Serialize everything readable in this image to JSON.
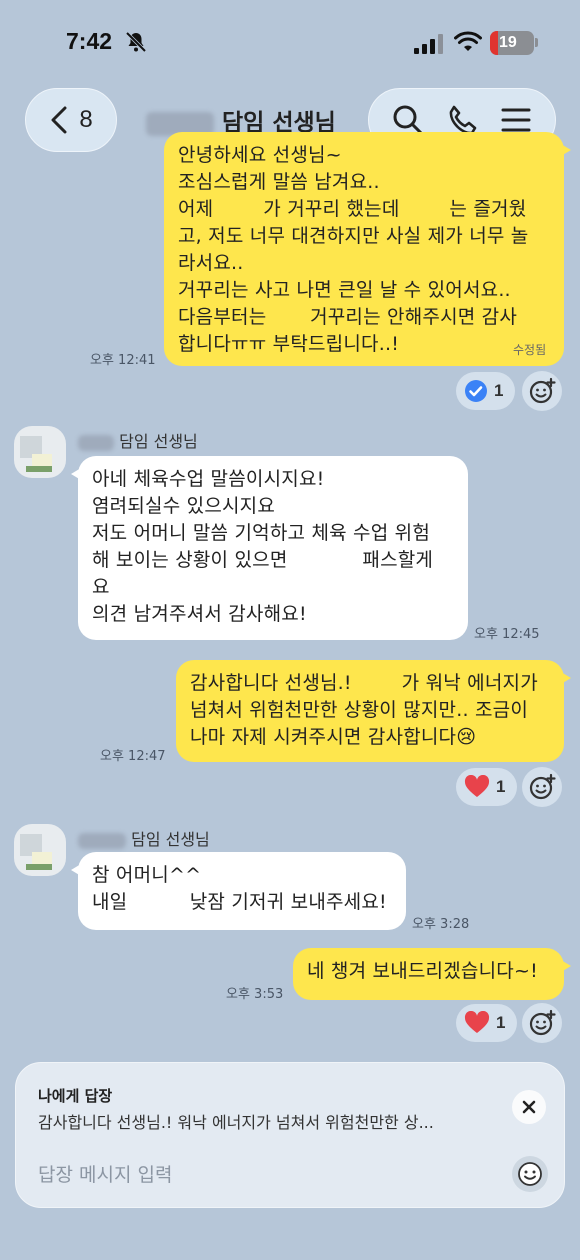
{
  "status_bar": {
    "time": "7:42",
    "battery": "19"
  },
  "header": {
    "back_count": "8",
    "title": "담임 선생님"
  },
  "messages": [
    {
      "side": "me",
      "text": "안녕하세요 선생님~\n조심스럽게 말씀 남겨요..\n어제        가 거꾸리 했는데        는 즐거웠\n고, 저도 너무 대견하지만 사실 제가 너무 놀\n라서요..\n거꾸리는 사고 나면 큰일 날 수 있어서요..\n다음부터는       거꾸리는 안해주시면 감사\n합니다ㅠㅠ 부탁드립니다..!",
      "time": "오후 12:41",
      "edited": "수정됨",
      "reaction_count": "1"
    },
    {
      "side": "them",
      "sender": "담임 선생님",
      "text": "아네 체육수업 말씀이시지요!\n염려되실수 있으시지요\n저도 어머니 말씀 기억하고 체육 수업 위험\n해 보이는 상황이 있으면            패스할게\n요\n의견 남겨주셔서 감사해요!",
      "time": "오후 12:45"
    },
    {
      "side": "me",
      "text": "감사합니다 선생님.!        가 워낙 에너지가\n넘쳐서 위험천만한 상황이 많지만.. 조금이\n나마 자제 시켜주시면 감사합니다😢",
      "time": "오후 12:47",
      "reaction_count": "1"
    },
    {
      "side": "them",
      "sender": "담임 선생님",
      "text": "참 어머니^^\n내일          낮잠 기저귀 보내주세요!",
      "time": "오후 3:28"
    },
    {
      "side": "me",
      "text": "네 챙겨 보내드리겠습니다~!",
      "time": "오후 3:53",
      "reaction_count": "1"
    }
  ],
  "reply": {
    "label": "나에게 답장",
    "quote": "감사합니다 선생님.!        워낙 에너지가 넘쳐서 위험천만한 상...",
    "placeholder": "답장 메시지 입력"
  },
  "colors": {
    "background": "#b6c6d8",
    "my_bubble": "#fee64d",
    "their_bubble": "#ffffff",
    "heart": "#e8434b",
    "check": "#3b82f6"
  }
}
